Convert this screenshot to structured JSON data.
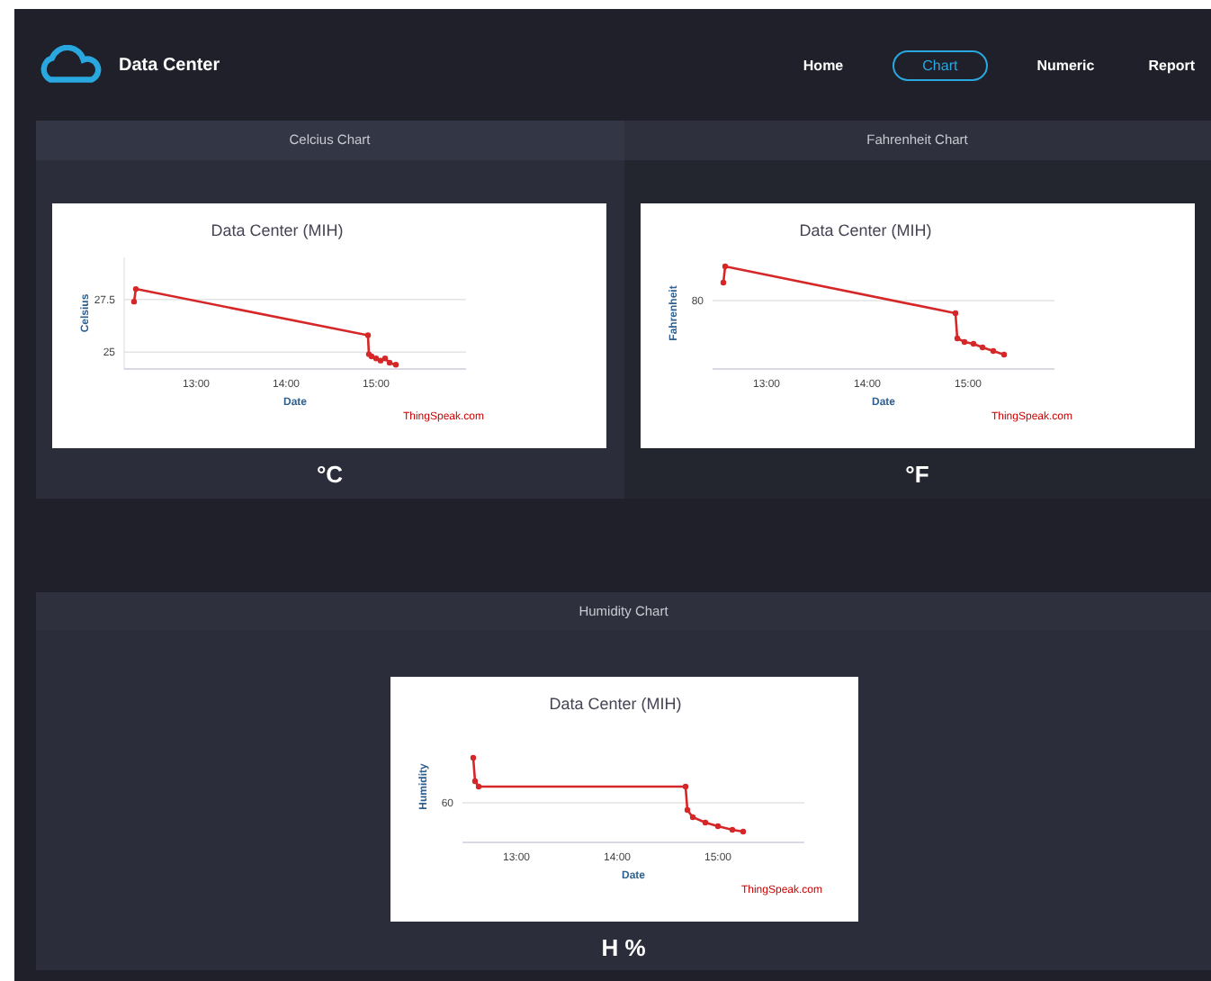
{
  "header": {
    "title": "Data Center"
  },
  "nav": [
    {
      "label": "Home",
      "selected": false
    },
    {
      "label": "Chart",
      "selected": true
    },
    {
      "label": "Numeric",
      "selected": false
    },
    {
      "label": "Report",
      "selected": false
    }
  ],
  "panels": [
    {
      "heading": "Celcius Chart",
      "unit": "°C",
      "credit": "ThingSpeak.com",
      "chart_data": {
        "type": "line",
        "title": "Data Center (MIH)",
        "xlabel": "Date",
        "ylabel": "Celsius",
        "x": [
          12.31,
          12.33,
          14.91,
          14.92,
          14.95,
          15.0,
          15.05,
          15.1,
          15.15,
          15.22
        ],
        "series": [
          {
            "color": "#d62728",
            "marker": true,
            "values": [
              27.4,
              28.0,
              25.8,
              24.9,
              24.8,
              24.7,
              24.6,
              24.7,
              24.5,
              24.4
            ]
          }
        ],
        "xlim": [
          12.2,
          16.0
        ],
        "ylim": [
          24.2,
          29.5
        ],
        "xticks": [
          {
            "value": 13,
            "label": "13:00"
          },
          {
            "value": 14,
            "label": "14:00"
          },
          {
            "value": 15,
            "label": "15:00"
          }
        ],
        "yticks": [
          {
            "value": 25,
            "label": "25"
          },
          {
            "value": 27.5,
            "label": "27.5"
          }
        ]
      }
    },
    {
      "heading": "Fahrenheit Chart",
      "unit": "°F",
      "credit": "ThingSpeak.com",
      "chart": {
        "kind": "falling",
        "title": "Data Center (MIH)",
        "xlabel": "Date",
        "ylabel": "Fahrenheit",
        "xticks": [
          "13:00",
          "14:00",
          "15:00"
        ],
        "ytick": "80"
      }
    },
    {
      "heading": "Humidity Chart",
      "unit": "H %",
      "credit": "ThingSpeak.com",
      "chart": {
        "kind": "step",
        "title": "Data Center (MIH)",
        "xlabel": "Date",
        "ylabel": "Humidity",
        "xticks": [
          "13:00",
          "14:00",
          "15:00"
        ],
        "ytick": "60"
      }
    }
  ]
}
